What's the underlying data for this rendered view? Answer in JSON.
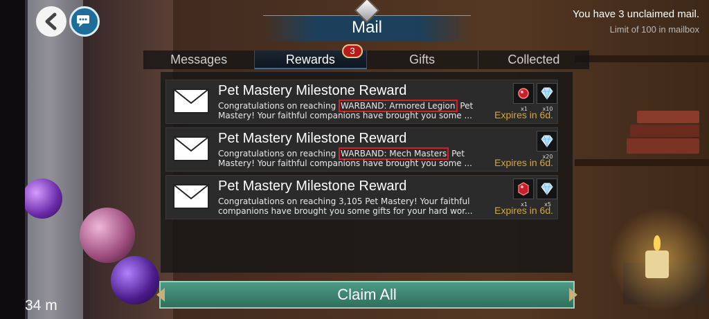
{
  "header": {
    "title": "Mail",
    "unclaimed_text": "You have 3 unclaimed mail.",
    "limit_text": "Limit of 100 in mailbox"
  },
  "tabs": [
    {
      "label": "Messages",
      "active": false
    },
    {
      "label": "Rewards",
      "active": true
    },
    {
      "label": "Gifts",
      "active": false
    },
    {
      "label": "Collected",
      "active": false
    }
  ],
  "rewards_badge": "3",
  "mails": [
    {
      "title": "Pet Mastery Milestone Reward",
      "body_pre": "Congratulations on reaching ",
      "body_highlight": "WARBAND: Armored Legion",
      "body_post": " Pet Mastery! Your faithful companions have brought you some ...",
      "expires": "Expires in 6d.",
      "rewards": [
        {
          "icon": "red-gem-icon",
          "qty": "x1"
        },
        {
          "icon": "diamond-icon",
          "qty": "x10"
        }
      ]
    },
    {
      "title": "Pet Mastery Milestone Reward",
      "body_pre": "Congratulations on reaching ",
      "body_highlight": "WARBAND: Mech Masters",
      "body_post": " Pet Mastery! Your faithful companions have brought you some ...",
      "expires": "Expires in 6d.",
      "rewards": [
        {
          "icon": "diamond-icon",
          "qty": "x20"
        }
      ]
    },
    {
      "title": "Pet Mastery Milestone Reward",
      "body_pre": "Congratulations on reaching 3,105 Pet Mastery! Your faithful companions have brought you some gifts for your hard wor...",
      "body_highlight": "",
      "body_post": "",
      "expires": "Expires in 6d.",
      "rewards": [
        {
          "icon": "red-gem-icon",
          "qty": "x1"
        },
        {
          "icon": "diamond-icon",
          "qty": "x5"
        }
      ]
    }
  ],
  "claim_all_label": "Claim All",
  "timer": "34 m",
  "colors": {
    "expires": "#d8a63a",
    "highlight_border": "#d2202a",
    "claim_button": "#3f8774",
    "badge": "#b51d1d"
  }
}
